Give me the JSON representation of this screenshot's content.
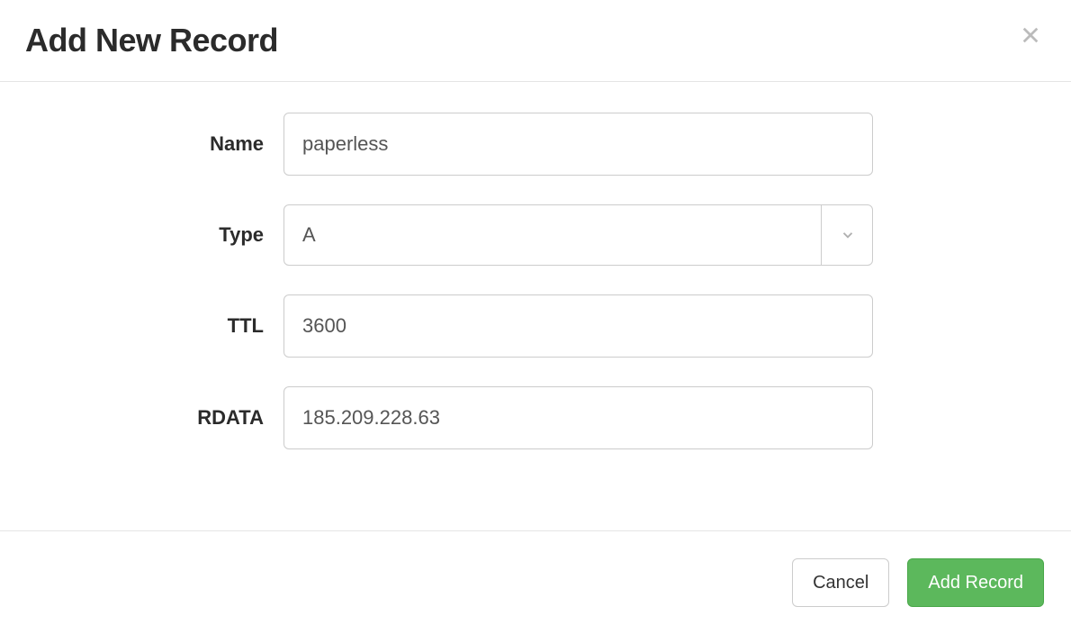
{
  "header": {
    "title": "Add New Record"
  },
  "form": {
    "name": {
      "label": "Name",
      "value": "paperless"
    },
    "type": {
      "label": "Type",
      "value": "A"
    },
    "ttl": {
      "label": "TTL",
      "value": "3600"
    },
    "rdata": {
      "label": "RDATA",
      "value": "185.209.228.63"
    }
  },
  "footer": {
    "cancel": "Cancel",
    "submit": "Add Record"
  }
}
